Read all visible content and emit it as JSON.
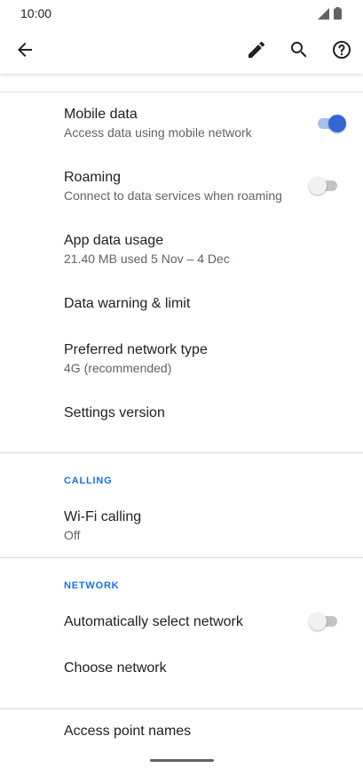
{
  "status_bar": {
    "time": "10:00",
    "icons": [
      "signal-icon",
      "battery-icon"
    ]
  },
  "app_bar": {
    "icons": [
      "back-arrow-icon",
      "edit-pencil-icon",
      "search-icon",
      "help-icon"
    ]
  },
  "settings": {
    "mobile_data": {
      "title": "Mobile data",
      "summary": "Access data using mobile network",
      "enabled": true
    },
    "roaming": {
      "title": "Roaming",
      "summary": "Connect to data services when roaming",
      "enabled": false
    },
    "app_data_usage": {
      "title": "App data usage",
      "summary": "21.40 MB used 5 Nov – 4 Dec"
    },
    "data_warning": {
      "title": "Data warning & limit"
    },
    "preferred_network": {
      "title": "Preferred network type",
      "summary": "4G (recommended)"
    },
    "settings_version": {
      "title": "Settings version"
    }
  },
  "calling": {
    "header": "CALLING",
    "wifi_calling": {
      "title": "Wi-Fi calling",
      "summary": "Off"
    }
  },
  "network": {
    "header": "NETWORK",
    "auto_select": {
      "title": "Automatically select network",
      "enabled": false
    },
    "choose_network": {
      "title": "Choose network"
    }
  },
  "apn": {
    "title": "Access point names"
  },
  "colors": {
    "accent": "#1a73e8",
    "switch_on": "#3367d6",
    "switch_track_on": "#a6c1ee"
  }
}
